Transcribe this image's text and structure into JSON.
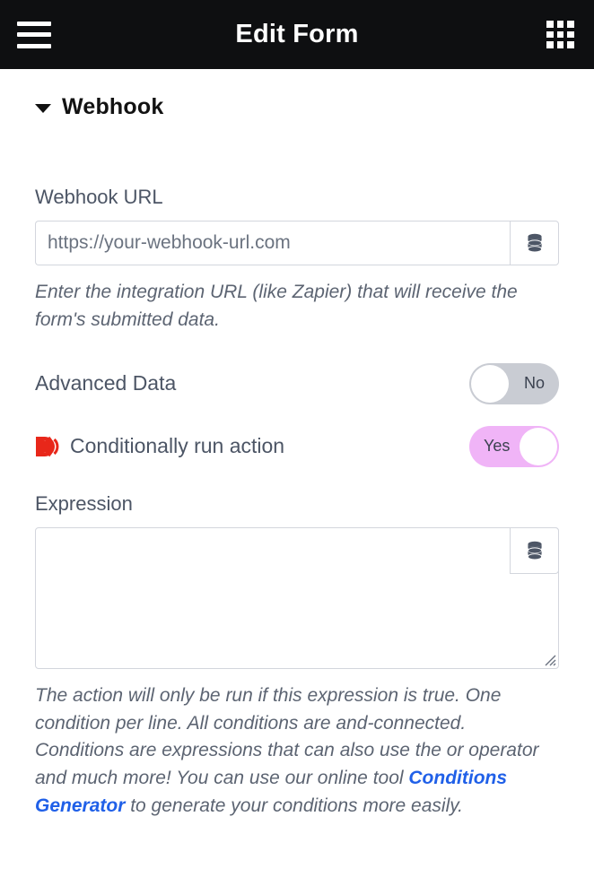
{
  "appbar": {
    "title": "Edit Form",
    "menu_icon": "hamburger-menu-icon",
    "apps_icon": "apps-grid-icon"
  },
  "section": {
    "title": "Webhook",
    "caret_icon": "chevron-down-icon",
    "expanded": true
  },
  "webhook_url": {
    "label": "Webhook URL",
    "value": "",
    "placeholder": "https://your-webhook-url.com",
    "addon_icon": "database-icon",
    "helper": "Enter the integration URL (like Zapier) that will receive the form's submitted data."
  },
  "advanced_data": {
    "label": "Advanced Data",
    "state": "No",
    "on": false
  },
  "conditionally_run": {
    "label": "Conditionally run action",
    "logo_icon": "deluge-d-logo-icon",
    "state": "Yes",
    "on": true
  },
  "expression": {
    "label": "Expression",
    "value": "",
    "placeholder": "",
    "addon_icon": "database-icon",
    "resize_icon": "resize-grip-icon",
    "helper_before_link": "The action will only be run if this expression is true. One condition per line. All conditions are and-connected. Conditions are expressions that can also use the or operator and much more! You can use our online tool ",
    "link_text": "Conditions Generator",
    "helper_after_link": " to generate your conditions more easily."
  },
  "colors": {
    "appbar_bg": "#0e0f11",
    "page_bg": "#ffffff",
    "label_text": "#4c5565",
    "helper_text": "#5c6472",
    "link": "#2060e8",
    "toggle_off_track": "#c9ccd3",
    "toggle_on_track": "#f0b4f7",
    "border": "#d3d6dd",
    "logo_red": "#e8271a"
  }
}
